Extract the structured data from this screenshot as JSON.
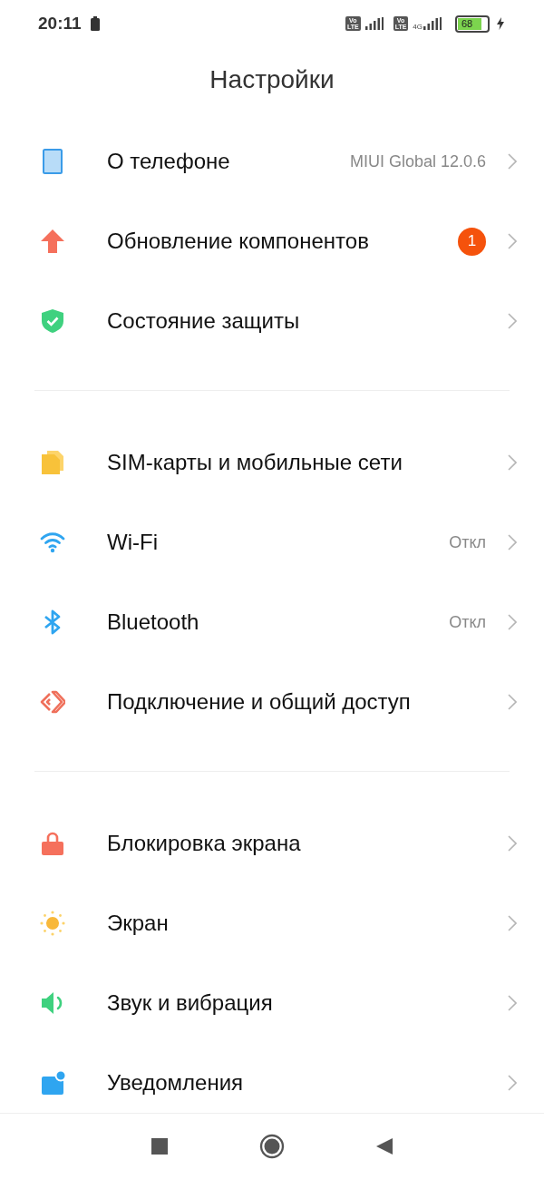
{
  "status_bar": {
    "time": "20:11",
    "sim_badges": [
      {
        "top": "Vo",
        "bottom": "LTE"
      },
      {
        "top": "Vo",
        "bottom": "LTE"
      }
    ],
    "network_type": "4G",
    "battery": "68"
  },
  "title": "Настройки",
  "groups": [
    [
      {
        "kind": "phone",
        "label": "О телефоне",
        "value": "MIUI Global 12.0.6"
      },
      {
        "kind": "update",
        "label": "Обновление компонентов",
        "badge": "1"
      },
      {
        "kind": "shield",
        "label": "Состояние защиты"
      }
    ],
    [
      {
        "kind": "sim",
        "label": "SIM-карты и мобильные сети"
      },
      {
        "kind": "wifi",
        "label": "Wi-Fi",
        "value": "Откл"
      },
      {
        "kind": "bluetooth",
        "label": "Bluetooth",
        "value": "Откл"
      },
      {
        "kind": "share",
        "label": "Подключение и общий доступ"
      }
    ],
    [
      {
        "kind": "lock",
        "label": "Блокировка экрана"
      },
      {
        "kind": "sun",
        "label": "Экран"
      },
      {
        "kind": "sound",
        "label": "Звук и вибрация"
      },
      {
        "kind": "notify",
        "label": "Уведомления"
      }
    ]
  ]
}
